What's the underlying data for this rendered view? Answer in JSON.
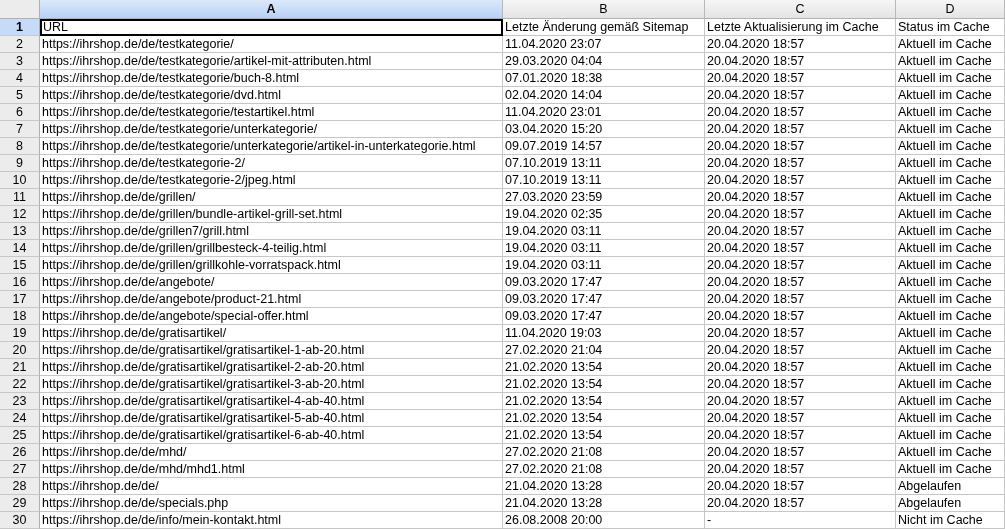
{
  "columns": [
    {
      "label": "A",
      "selected": true
    },
    {
      "label": "B",
      "selected": false
    },
    {
      "label": "C",
      "selected": false
    },
    {
      "label": "D",
      "selected": false
    }
  ],
  "rows": [
    {
      "number": "1",
      "selected": true,
      "cells": [
        "URL",
        "Letzte Änderung gemäß Sitemap",
        "Letzte Aktualisierung im Cache",
        "Status im Cache"
      ]
    },
    {
      "number": "2",
      "selected": false,
      "cells": [
        "https://ihrshop.de/de/testkategorie/",
        "11.04.2020 23:07",
        "20.04.2020 18:57",
        "Aktuell im Cache"
      ]
    },
    {
      "number": "3",
      "selected": false,
      "cells": [
        "https://ihrshop.de/de/testkategorie/artikel-mit-attributen.html",
        "29.03.2020 04:04",
        "20.04.2020 18:57",
        "Aktuell im Cache"
      ]
    },
    {
      "number": "4",
      "selected": false,
      "cells": [
        "https://ihrshop.de/de/testkategorie/buch-8.html",
        "07.01.2020 18:38",
        "20.04.2020 18:57",
        "Aktuell im Cache"
      ]
    },
    {
      "number": "5",
      "selected": false,
      "cells": [
        "https://ihrshop.de/de/testkategorie/dvd.html",
        "02.04.2020 14:04",
        "20.04.2020 18:57",
        "Aktuell im Cache"
      ]
    },
    {
      "number": "6",
      "selected": false,
      "cells": [
        "https://ihrshop.de/de/testkategorie/testartikel.html",
        "11.04.2020 23:01",
        "20.04.2020 18:57",
        "Aktuell im Cache"
      ]
    },
    {
      "number": "7",
      "selected": false,
      "cells": [
        "https://ihrshop.de/de/testkategorie/unterkategorie/",
        "03.04.2020 15:20",
        "20.04.2020 18:57",
        "Aktuell im Cache"
      ]
    },
    {
      "number": "8",
      "selected": false,
      "cells": [
        "https://ihrshop.de/de/testkategorie/unterkategorie/artikel-in-unterkategorie.html",
        "09.07.2019 14:57",
        "20.04.2020 18:57",
        "Aktuell im Cache"
      ]
    },
    {
      "number": "9",
      "selected": false,
      "cells": [
        "https://ihrshop.de/de/testkategorie-2/",
        "07.10.2019 13:11",
        "20.04.2020 18:57",
        "Aktuell im Cache"
      ]
    },
    {
      "number": "10",
      "selected": false,
      "cells": [
        "https://ihrshop.de/de/testkategorie-2/jpeg.html",
        "07.10.2019 13:11",
        "20.04.2020 18:57",
        "Aktuell im Cache"
      ]
    },
    {
      "number": "11",
      "selected": false,
      "cells": [
        "https://ihrshop.de/de/grillen/",
        "27.03.2020 23:59",
        "20.04.2020 18:57",
        "Aktuell im Cache"
      ]
    },
    {
      "number": "12",
      "selected": false,
      "cells": [
        "https://ihrshop.de/de/grillen/bundle-artikel-grill-set.html",
        "19.04.2020 02:35",
        "20.04.2020 18:57",
        "Aktuell im Cache"
      ]
    },
    {
      "number": "13",
      "selected": false,
      "cells": [
        "https://ihrshop.de/de/grillen7/grill.html",
        "19.04.2020 03:11",
        "20.04.2020 18:57",
        "Aktuell im Cache"
      ]
    },
    {
      "number": "14",
      "selected": false,
      "cells": [
        "https://ihrshop.de/de/grillen/grillbesteck-4-teilig.html",
        "19.04.2020 03:11",
        "20.04.2020 18:57",
        "Aktuell im Cache"
      ]
    },
    {
      "number": "15",
      "selected": false,
      "cells": [
        "https://ihrshop.de/de/grillen/grillkohle-vorratspack.html",
        "19.04.2020 03:11",
        "20.04.2020 18:57",
        "Aktuell im Cache"
      ]
    },
    {
      "number": "16",
      "selected": false,
      "cells": [
        "https://ihrshop.de/de/angebote/",
        "09.03.2020 17:47",
        "20.04.2020 18:57",
        "Aktuell im Cache"
      ]
    },
    {
      "number": "17",
      "selected": false,
      "cells": [
        "https://ihrshop.de/de/angebote/product-21.html",
        "09.03.2020 17:47",
        "20.04.2020 18:57",
        "Aktuell im Cache"
      ]
    },
    {
      "number": "18",
      "selected": false,
      "cells": [
        "https://ihrshop.de/de/angebote/special-offer.html",
        "09.03.2020 17:47",
        "20.04.2020 18:57",
        "Aktuell im Cache"
      ]
    },
    {
      "number": "19",
      "selected": false,
      "cells": [
        "https://ihrshop.de/de/gratisartikel/",
        "11.04.2020 19:03",
        "20.04.2020 18:57",
        "Aktuell im Cache"
      ]
    },
    {
      "number": "20",
      "selected": false,
      "cells": [
        "https://ihrshop.de/de/gratisartikel/gratisartikel-1-ab-20.html",
        "27.02.2020 21:04",
        "20.04.2020 18:57",
        "Aktuell im Cache"
      ]
    },
    {
      "number": "21",
      "selected": false,
      "cells": [
        "https://ihrshop.de/de/gratisartikel/gratisartikel-2-ab-20.html",
        "21.02.2020 13:54",
        "20.04.2020 18:57",
        "Aktuell im Cache"
      ]
    },
    {
      "number": "22",
      "selected": false,
      "cells": [
        "https://ihrshop.de/de/gratisartikel/gratisartikel-3-ab-20.html",
        "21.02.2020 13:54",
        "20.04.2020 18:57",
        "Aktuell im Cache"
      ]
    },
    {
      "number": "23",
      "selected": false,
      "cells": [
        "https://ihrshop.de/de/gratisartikel/gratisartikel-4-ab-40.html",
        "21.02.2020 13:54",
        "20.04.2020 18:57",
        "Aktuell im Cache"
      ]
    },
    {
      "number": "24",
      "selected": false,
      "cells": [
        "https://ihrshop.de/de/gratisartikel/gratisartikel-5-ab-40.html",
        "21.02.2020 13:54",
        "20.04.2020 18:57",
        "Aktuell im Cache"
      ]
    },
    {
      "number": "25",
      "selected": false,
      "cells": [
        "https://ihrshop.de/de/gratisartikel/gratisartikel-6-ab-40.html",
        "21.02.2020 13:54",
        "20.04.2020 18:57",
        "Aktuell im Cache"
      ]
    },
    {
      "number": "26",
      "selected": false,
      "cells": [
        "https://ihrshop.de/de/mhd/",
        "27.02.2020 21:08",
        "20.04.2020 18:57",
        "Aktuell im Cache"
      ]
    },
    {
      "number": "27",
      "selected": false,
      "cells": [
        "https://ihrshop.de/de/mhd/mhd1.html",
        "27.02.2020 21:08",
        "20.04.2020 18:57",
        "Aktuell im Cache"
      ]
    },
    {
      "number": "28",
      "selected": false,
      "cells": [
        "https://ihrshop.de/de/",
        "21.04.2020 13:28",
        "20.04.2020 18:57",
        "Abgelaufen"
      ]
    },
    {
      "number": "29",
      "selected": false,
      "cells": [
        "https://ihrshop.de/de/specials.php",
        "21.04.2020 13:28",
        "20.04.2020 18:57",
        "Abgelaufen"
      ]
    },
    {
      "number": "30",
      "selected": false,
      "cells": [
        "https://ihrshop.de/de/info/mein-kontakt.html",
        "26.08.2008 20:00",
        "-",
        "Nicht im Cache"
      ]
    }
  ]
}
